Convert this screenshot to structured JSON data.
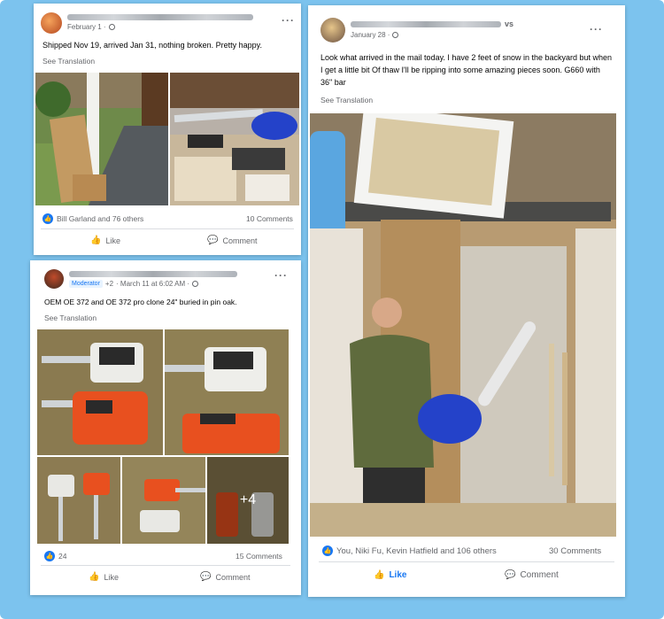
{
  "post1": {
    "meta_date": "February 1 ·",
    "text": "Shipped Nov 19, arrived Jan 31, nothing broken. Pretty happy.",
    "see_translation": "See Translation",
    "reactions": "Bill Garland and 76 others",
    "comments": "10 Comments",
    "like_label": "Like",
    "comment_label": "Comment"
  },
  "post2": {
    "badge": "Moderator",
    "plus_count": "+2",
    "meta_date": "· March 11 at 6:02 AM ·",
    "text": "OEM OE 372 and OE  372 pro clone 24\" buried in pin oak.",
    "see_translation": "See Translation",
    "reactions": "24",
    "comments": "15 Comments",
    "more_photos": "+4",
    "like_label": "Like",
    "comment_label": "Comment"
  },
  "post3": {
    "author_suffix": "vs",
    "meta_date": "January 28 ·",
    "text": "Look what arrived in the mail today. I have 2 feet of snow in the backyard but when I get a little bit Of thaw I'll be ripping into some amazing pieces soon. G660 with 36\" bar",
    "see_translation": "See Translation",
    "reactions": "You, Niki Fu, Kevin Hatfield and 106 others",
    "comments": "30 Comments",
    "like_label": "Like",
    "comment_label": "Comment"
  },
  "colors": {
    "background": "#7cc3ee",
    "facebook_blue": "#1877f2",
    "muted_text": "#65676b",
    "saw_orange": "#e8501f",
    "saw_blue": "#2442c9"
  },
  "icons": [
    "more-options-icon",
    "globe-icon",
    "like-reaction-icon",
    "thumbs-up-icon",
    "comment-icon"
  ]
}
